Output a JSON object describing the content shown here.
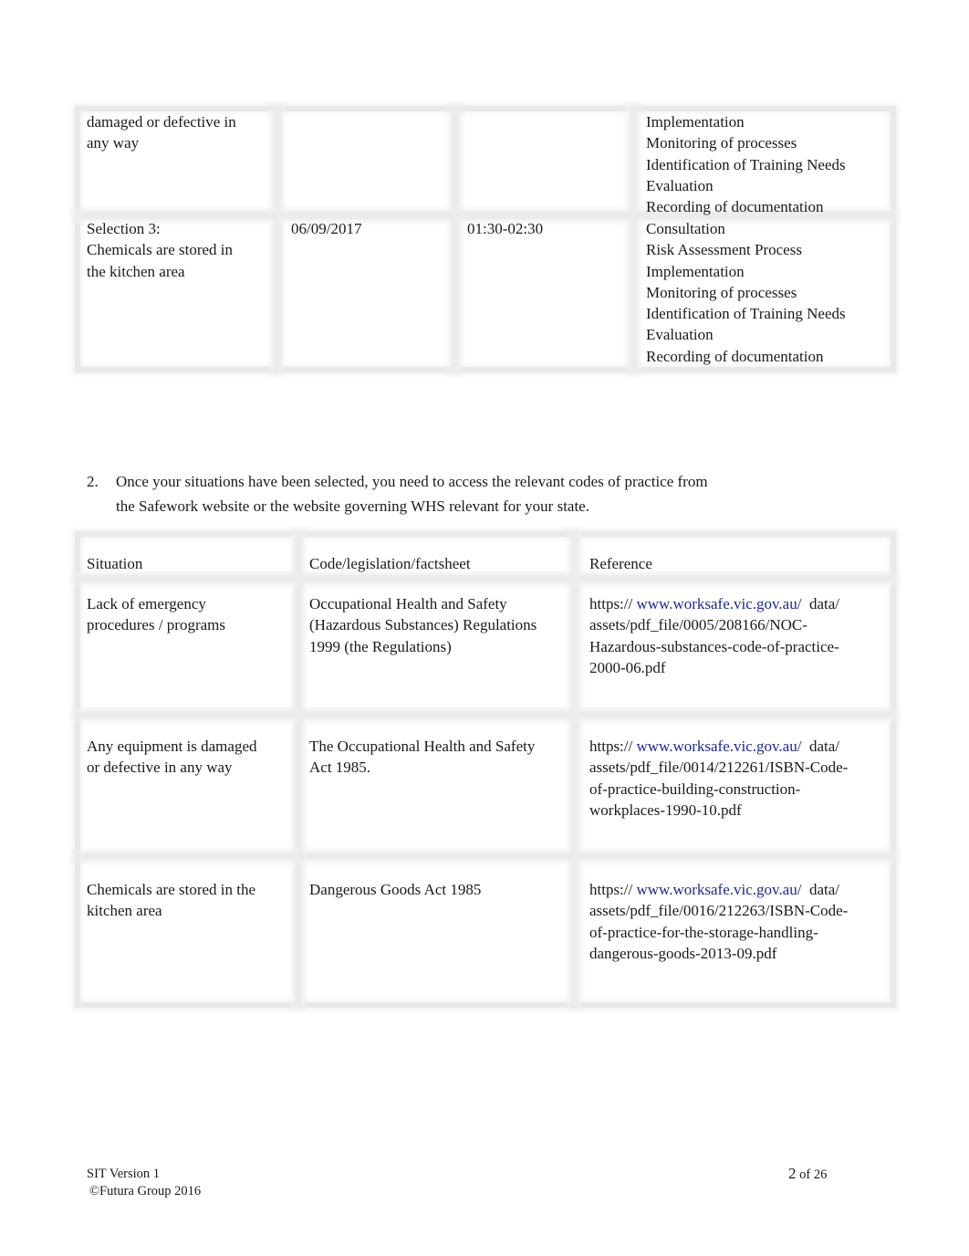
{
  "table1": {
    "rows": [
      {
        "situation_lines": [
          "damaged or defective in",
          "any way"
        ],
        "date": "",
        "time": "",
        "process_lines": [
          "Implementation",
          "Monitoring of processes",
          "Identification of Training Needs",
          "Evaluation",
          "Recording of documentation"
        ]
      },
      {
        "situation_lines": [
          "Selection 3:",
          "Chemicals are stored in",
          "the kitchen area"
        ],
        "date": "06/09/2017",
        "time": "01:30-02:30",
        "process_lines": [
          "Consultation",
          "Risk Assessment Process",
          "Implementation",
          "Monitoring of processes",
          "Identification of Training Needs",
          "Evaluation",
          "Recording of documentation"
        ]
      }
    ]
  },
  "question": {
    "number": "2.",
    "lines": [
      "Once your situations have been selected, you need to access the relevant codes of practice from",
      "the Safework website or the website governing WHS relevant for your state."
    ]
  },
  "table2": {
    "headers": [
      "Situation",
      "Code/legislation/factsheet",
      "Reference"
    ],
    "rows": [
      {
        "situation_lines": [
          "Lack of emergency",
          "procedures / programs"
        ],
        "code_lines": [
          "Occupational Health and Safety",
          "(Hazardous Substances) Regulations",
          "1999 (the Regulations)"
        ],
        "ref_prefix": "https://",
        "ref_link": "www.worksafe.vic.gov.au/",
        "ref_suffix": "data/",
        "ref_lines": [
          "assets/pdf_file/0005/208166/NOC-",
          "Hazardous-substances-code-of-practice-",
          "2000-06.pdf"
        ]
      },
      {
        "situation_lines": [
          "Any equipment is damaged",
          "or defective in any way"
        ],
        "code_lines": [
          "The Occupational Health and Safety",
          "Act 1985."
        ],
        "ref_prefix": "https://",
        "ref_link": "www.worksafe.vic.gov.au/",
        "ref_suffix": "data/",
        "ref_lines": [
          "assets/pdf_file/0014/212261/ISBN-Code-",
          "of-practice-building-construction-",
          "workplaces-1990-10.pdf"
        ]
      },
      {
        "situation_lines": [
          "Chemicals are stored in the",
          "kitchen area"
        ],
        "code_lines": [
          "Dangerous Goods Act 1985"
        ],
        "ref_prefix": "https://",
        "ref_link": "www.worksafe.vic.gov.au/",
        "ref_suffix": "data/",
        "ref_lines": [
          "assets/pdf_file/0016/212263/ISBN-Code-",
          "of-practice-for-the-storage-handling-",
          "dangerous-goods-2013-09.pdf"
        ]
      }
    ]
  },
  "footer": {
    "version": "SIT Version 1",
    "copyright": "©Futura Group 2016",
    "page_current": "2",
    "page_of": "of 26"
  },
  "colors": {
    "link": "#1f2a8c",
    "text": "#1a1a1a",
    "grid": "#ececec"
  }
}
